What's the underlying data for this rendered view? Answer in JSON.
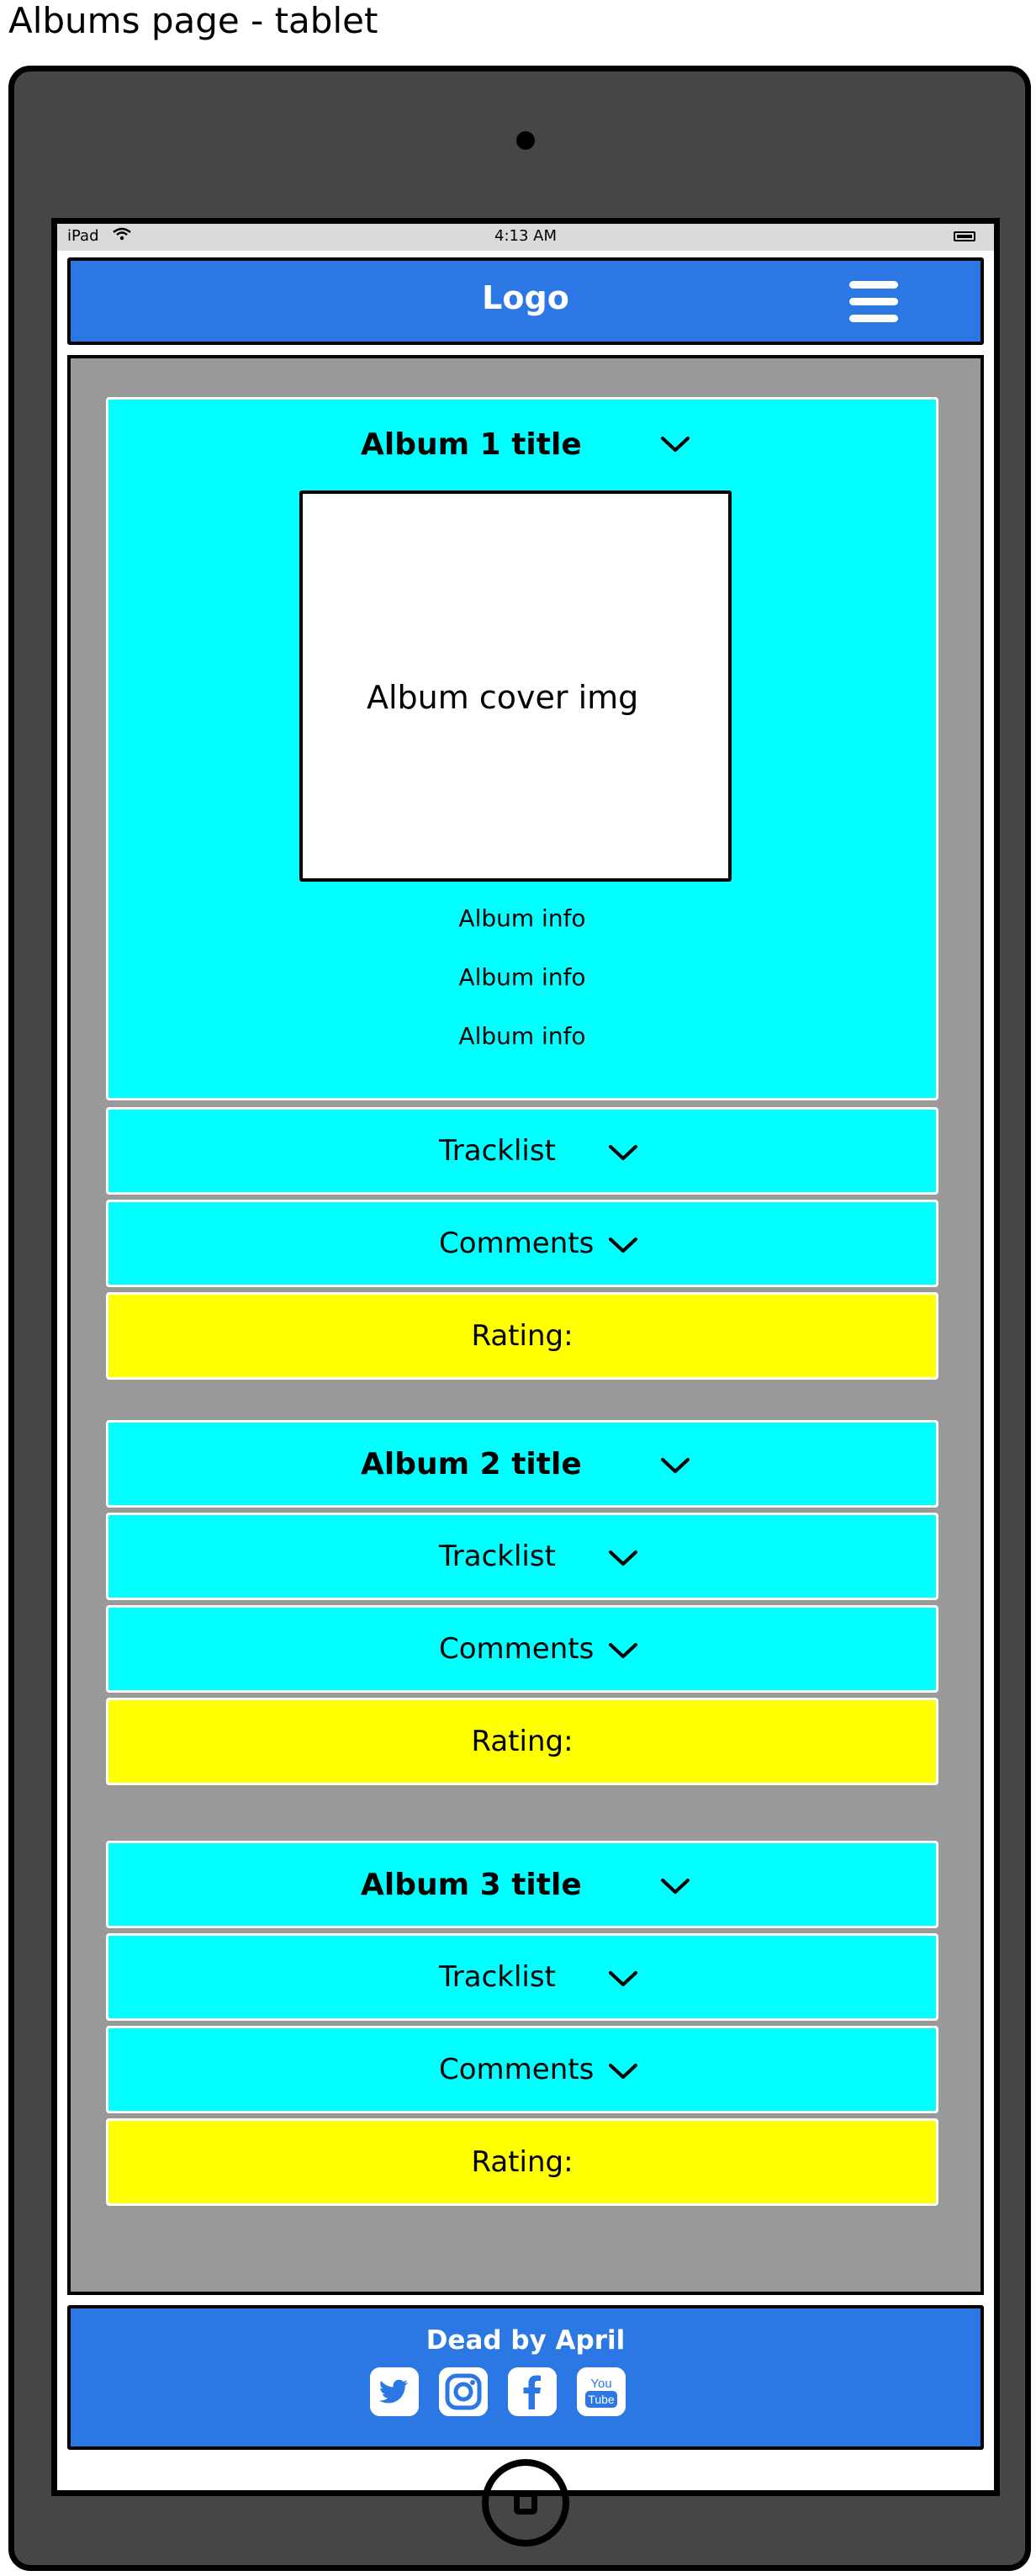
{
  "caption": "Albums page - tablet",
  "status_bar": {
    "carrier": "iPad",
    "time": "4:13 AM"
  },
  "header": {
    "logo": "Logo"
  },
  "albums": [
    {
      "title": "Album 1 title",
      "cover_label": "Album cover img",
      "info": [
        "Album info",
        "Album info",
        "Album info"
      ],
      "tracklist_label": "Tracklist",
      "comments_label": "Comments",
      "rating_label": "Rating:"
    },
    {
      "title": "Album 2 title",
      "tracklist_label": "Tracklist",
      "comments_label": "Comments",
      "rating_label": "Rating:"
    },
    {
      "title": "Album 3 title",
      "tracklist_label": "Tracklist",
      "comments_label": "Comments",
      "rating_label": "Rating:"
    }
  ],
  "footer": {
    "band_name": "Dead by April",
    "social_icons": [
      "twitter-icon",
      "instagram-icon",
      "facebook-icon",
      "youtube-icon"
    ],
    "youtube_text": [
      "You",
      "Tube"
    ]
  },
  "colors": {
    "header_blue": "#2b78e4",
    "panel_cyan": "#00ffff",
    "rating_yellow": "#ffff00",
    "content_gray": "#999999",
    "device_frame": "#464646"
  }
}
